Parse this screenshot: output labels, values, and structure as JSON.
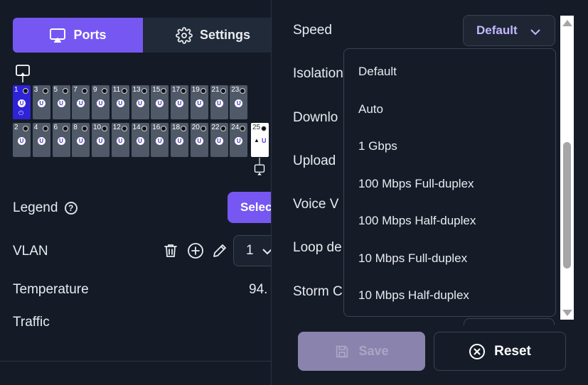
{
  "tabs": [
    {
      "label": "Ports",
      "icon": "cast-icon",
      "active": true
    },
    {
      "label": "Settings",
      "icon": "gear-icon",
      "active": false
    }
  ],
  "switch": {
    "ports_top": [
      {
        "num": "1",
        "selected": true
      },
      {
        "num": "3"
      },
      {
        "num": "5"
      },
      {
        "num": "7"
      },
      {
        "num": "9"
      },
      {
        "num": "11"
      },
      {
        "num": "13"
      },
      {
        "num": "15"
      },
      {
        "num": "17"
      },
      {
        "num": "19"
      },
      {
        "num": "21"
      },
      {
        "num": "23"
      }
    ],
    "ports_bottom": [
      {
        "num": "2"
      },
      {
        "num": "4"
      },
      {
        "num": "6"
      },
      {
        "num": "8"
      },
      {
        "num": "10"
      },
      {
        "num": "12"
      },
      {
        "num": "14"
      },
      {
        "num": "16"
      },
      {
        "num": "18"
      },
      {
        "num": "20"
      },
      {
        "num": "22"
      },
      {
        "num": "24"
      }
    ],
    "sfp_port": {
      "num": "25",
      "badge": "U"
    },
    "untagged_badge": "U",
    "colors": {
      "port": "#4f5967",
      "selected": "#2f23d8",
      "accent": "#7657f2"
    }
  },
  "left": {
    "legend_label": "Legend",
    "legend_help": "?",
    "select_button": "Selec",
    "vlan_label": "VLAN",
    "vlan_value": "1",
    "temperature_label": "Temperature",
    "temperature_value": "94.",
    "traffic_label": "Traffic"
  },
  "form": {
    "speed_label": "Speed",
    "speed_value": "Default",
    "isolation_label": "Isolation",
    "download_label": "Downlo",
    "upload_label": "Upload",
    "voice_label": "Voice V",
    "loop_label": "Loop de",
    "storm_label": "Storm C"
  },
  "speed_options": [
    "Default",
    "Auto",
    "1 Gbps",
    "100 Mbps Full-duplex",
    "100 Mbps Half-duplex",
    "10 Mbps Full-duplex",
    "10 Mbps Half-duplex"
  ],
  "buttons": {
    "save": "Save",
    "reset": "Reset"
  }
}
